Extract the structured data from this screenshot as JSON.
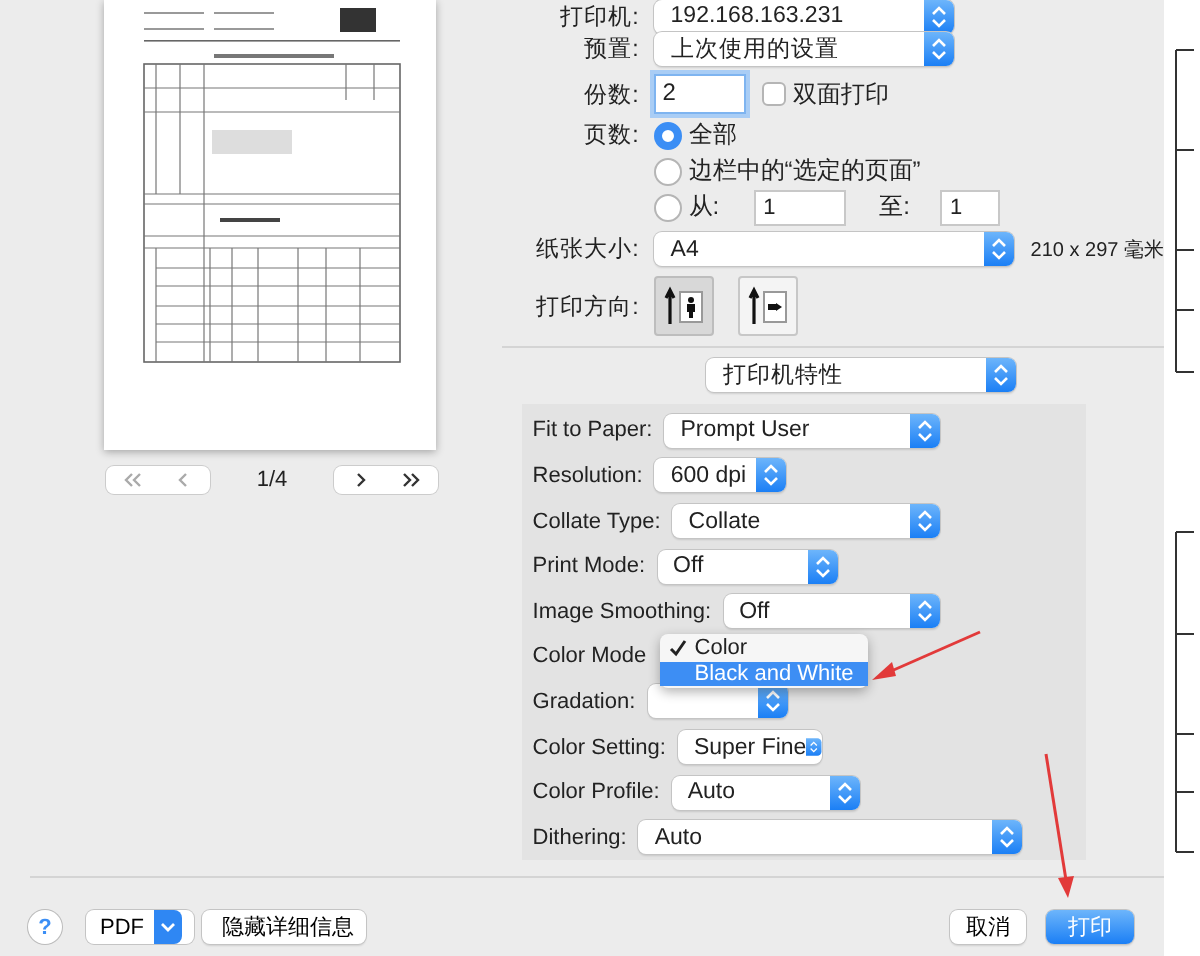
{
  "printer": {
    "label": "打印机:",
    "value": "192.168.163.231"
  },
  "presets": {
    "label": "预置:",
    "value": "上次使用的设置"
  },
  "copies": {
    "label": "份数:",
    "value": "2",
    "duplex": {
      "label": "双面打印",
      "checked": false
    }
  },
  "pages": {
    "label": "页数:",
    "options": [
      {
        "kind": "plain",
        "label": "全部",
        "selected": true
      },
      {
        "kind": "plain",
        "label": "边栏中的“选定的页面”",
        "selected": false
      },
      {
        "kind": "range",
        "label": "从:",
        "selected": false,
        "from": "1",
        "to_label": "至:",
        "to": "1"
      }
    ]
  },
  "paper_size": {
    "label": "纸张大小:",
    "value": "A4",
    "dimensions": "210 x 297 毫米"
  },
  "orientation": {
    "label": "打印方向:",
    "options": [
      {
        "kind": "portrait",
        "selected": true
      },
      {
        "kind": "landscape",
        "selected": false
      }
    ]
  },
  "section_menu": {
    "value": "打印机特性"
  },
  "features": [
    {
      "kind": "popup",
      "label": "Fit to Paper:",
      "value": "Prompt User"
    },
    {
      "kind": "popup",
      "label": "Resolution:",
      "value": "600 dpi"
    },
    {
      "kind": "popup",
      "label": "Collate Type:",
      "value": "Collate"
    },
    {
      "kind": "popup",
      "label": "Print Mode:",
      "value": "Off"
    },
    {
      "kind": "popup",
      "label": "Image Smoothing:",
      "value": "Off"
    },
    {
      "kind": "menu",
      "label": "Color Mode",
      "items": [
        {
          "label": "Color",
          "checked": true,
          "selected": false
        },
        {
          "label": "Black and White",
          "checked": false,
          "selected": true
        }
      ]
    },
    {
      "kind": "covered",
      "label": "Gradation:"
    },
    {
      "kind": "popup",
      "label": "Color Setting:",
      "value": "Super Fine"
    },
    {
      "kind": "popup",
      "label": "Color Profile:",
      "value": "Auto"
    },
    {
      "kind": "popup",
      "label": "Dithering:",
      "value": "Auto"
    }
  ],
  "preview": {
    "page": "1/4"
  },
  "footer": {
    "help": "?",
    "pdf": "PDF",
    "details_button": "隐藏详细信息",
    "cancel": "取消",
    "print": "打印"
  }
}
